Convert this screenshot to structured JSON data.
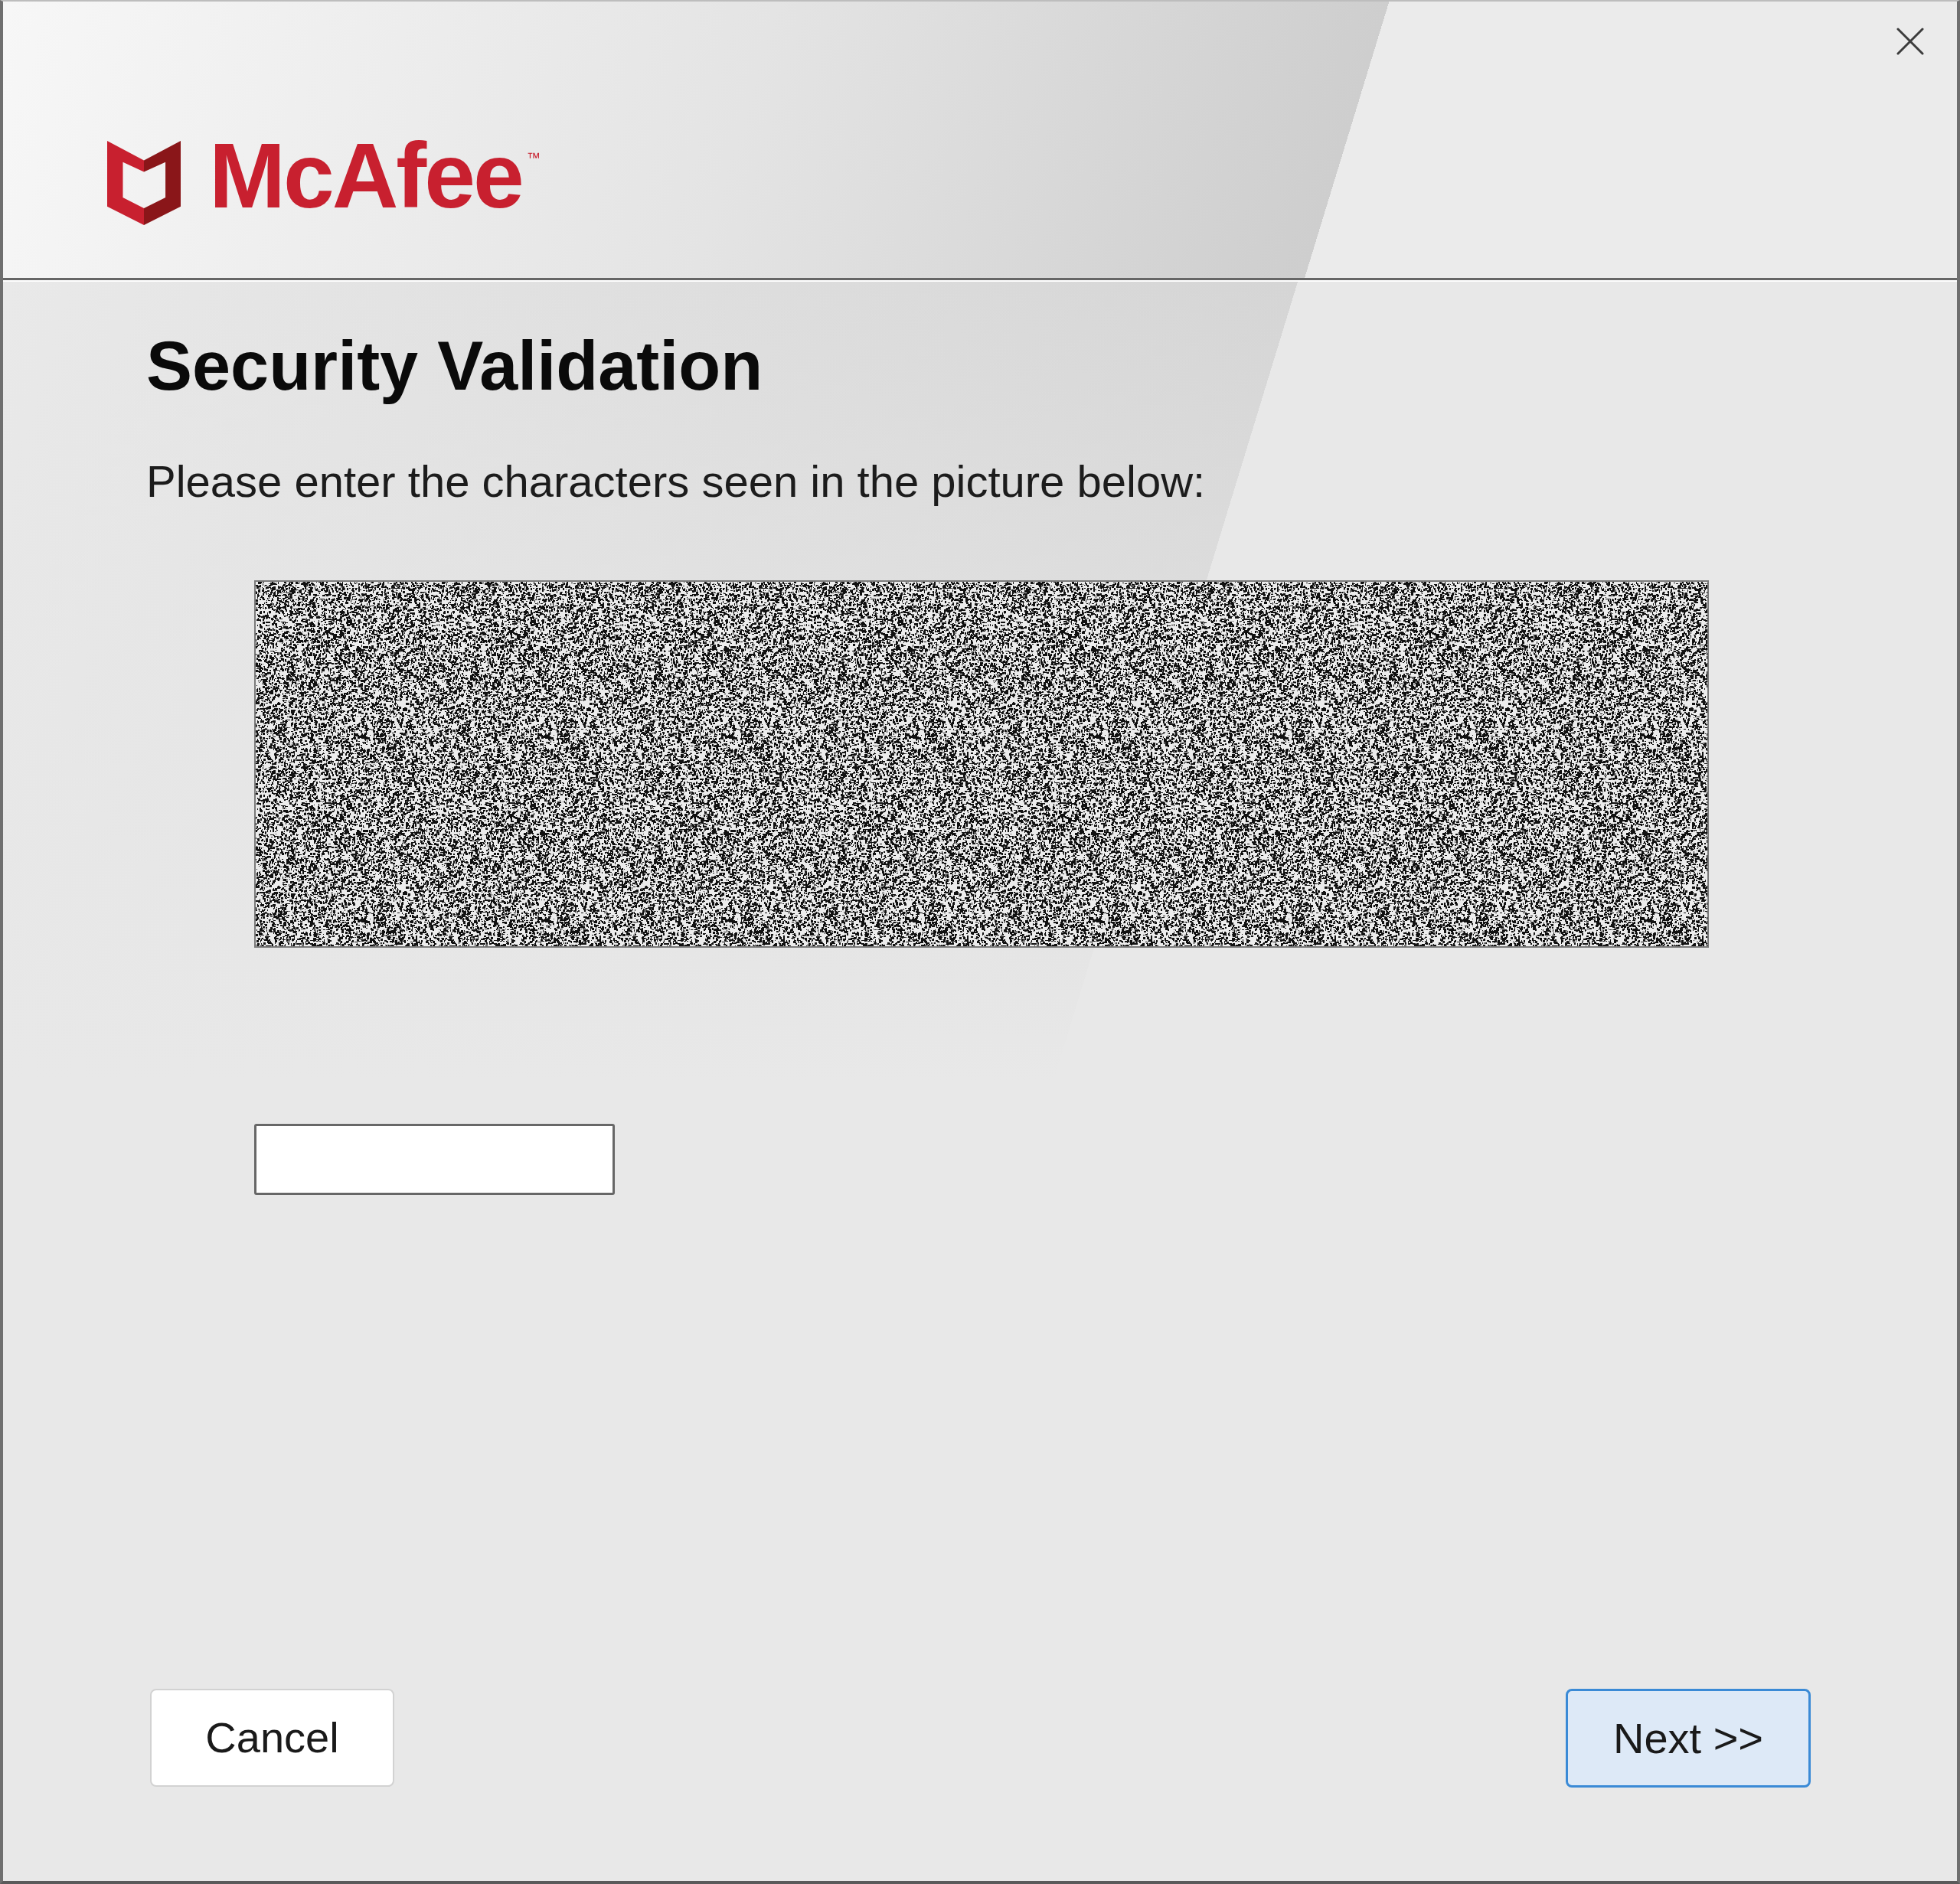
{
  "header": {
    "logo": {
      "wordmark": "McAfee",
      "trademark": "™"
    }
  },
  "page": {
    "title": "Security Validation",
    "instruction": "Please enter the characters seen in the picture below:"
  },
  "answer_field": {
    "disabled": false
  },
  "buttons": [
    {
      "label": "Cancel",
      "default": false
    },
    {
      "label": "Next >>",
      "default": true
    }
  ]
}
